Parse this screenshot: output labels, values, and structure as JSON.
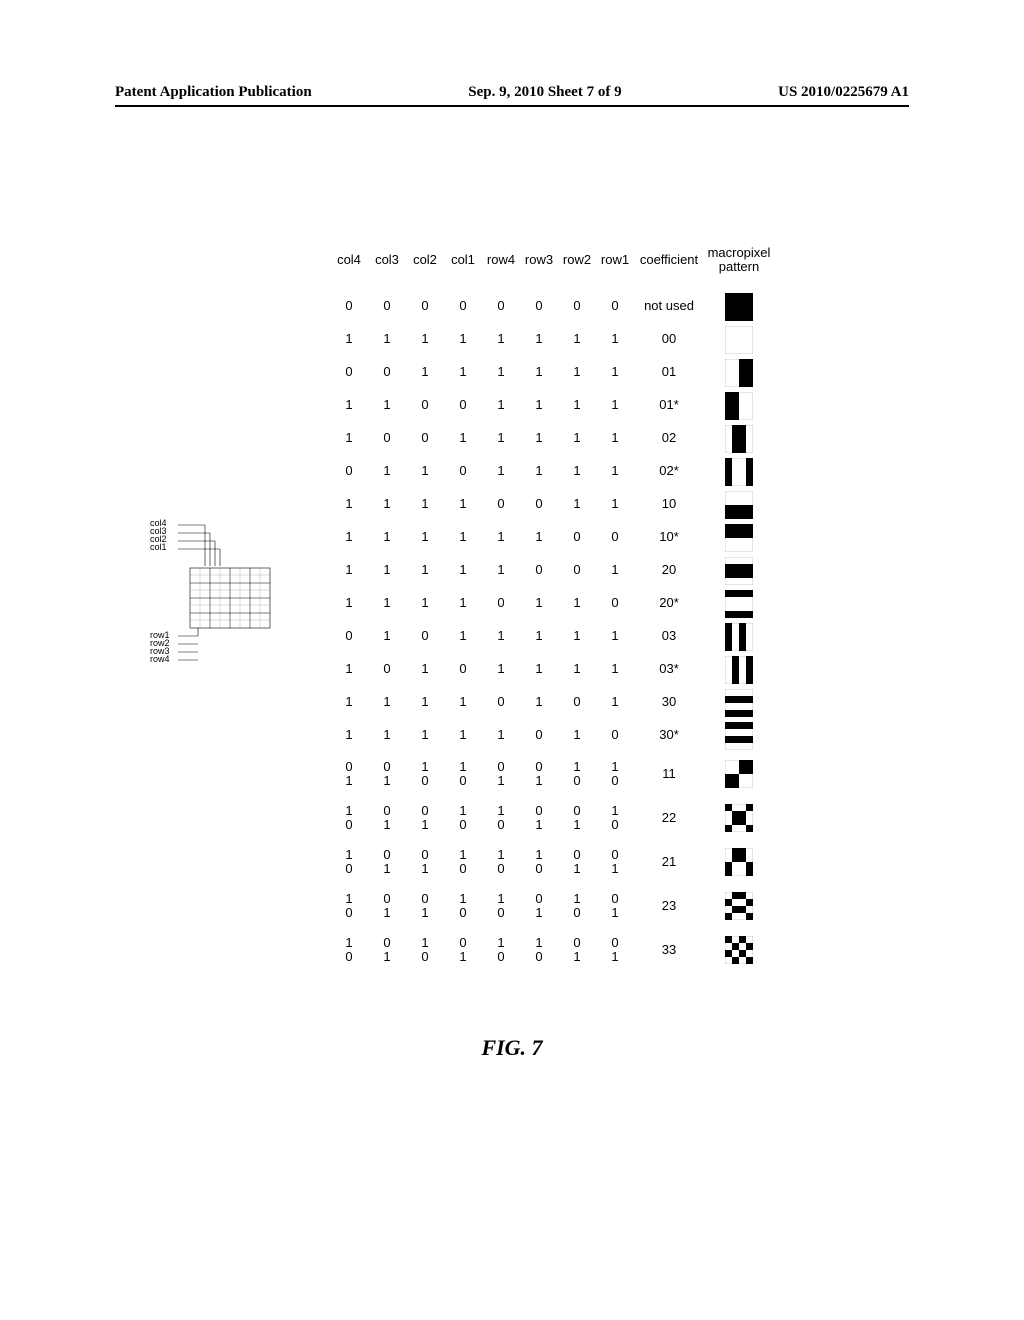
{
  "header": {
    "left": "Patent Application Publication",
    "center": "Sep. 9, 2010  Sheet 7 of 9",
    "right": "US 2010/0225679 A1"
  },
  "figure_caption": "FIG. 7",
  "table": {
    "headers": [
      "col4",
      "col3",
      "col2",
      "col1",
      "row4",
      "row3",
      "row2",
      "row1",
      "coefficient",
      "macropixel pattern"
    ],
    "rows": [
      {
        "cols": [
          "0",
          "0",
          "0",
          "0",
          "0",
          "0",
          "0",
          "0"
        ],
        "coef": "not used",
        "pat": "full"
      },
      {
        "cols": [
          "1",
          "1",
          "1",
          "1",
          "1",
          "1",
          "1",
          "1"
        ],
        "coef": "00",
        "pat": "empty"
      },
      {
        "cols": [
          "0",
          "0",
          "1",
          "1",
          "1",
          "1",
          "1",
          "1"
        ],
        "coef": "01",
        "pat": "right-half"
      },
      {
        "cols": [
          "1",
          "1",
          "0",
          "0",
          "1",
          "1",
          "1",
          "1"
        ],
        "coef": "01*",
        "pat": "left-half"
      },
      {
        "cols": [
          "1",
          "0",
          "0",
          "1",
          "1",
          "1",
          "1",
          "1"
        ],
        "coef": "02",
        "pat": "mid-cols"
      },
      {
        "cols": [
          "0",
          "1",
          "1",
          "0",
          "1",
          "1",
          "1",
          "1"
        ],
        "coef": "02*",
        "pat": "out-cols"
      },
      {
        "cols": [
          "1",
          "1",
          "1",
          "1",
          "0",
          "0",
          "1",
          "1"
        ],
        "coef": "10",
        "pat": "bot-half"
      },
      {
        "cols": [
          "1",
          "1",
          "1",
          "1",
          "1",
          "1",
          "0",
          "0"
        ],
        "coef": "10*",
        "pat": "top-half"
      },
      {
        "cols": [
          "1",
          "1",
          "1",
          "1",
          "1",
          "0",
          "0",
          "1"
        ],
        "coef": "20",
        "pat": "mid-rows"
      },
      {
        "cols": [
          "1",
          "1",
          "1",
          "1",
          "0",
          "1",
          "1",
          "0"
        ],
        "coef": "20*",
        "pat": "out-rows"
      },
      {
        "cols": [
          "0",
          "1",
          "0",
          "1",
          "1",
          "1",
          "1",
          "1"
        ],
        "coef": "03",
        "pat": "alt-cols-a"
      },
      {
        "cols": [
          "1",
          "0",
          "1",
          "0",
          "1",
          "1",
          "1",
          "1"
        ],
        "coef": "03*",
        "pat": "alt-cols-b"
      },
      {
        "cols": [
          "1",
          "1",
          "1",
          "1",
          "0",
          "1",
          "0",
          "1"
        ],
        "coef": "30",
        "pat": "alt-rows-a"
      },
      {
        "cols": [
          "1",
          "1",
          "1",
          "1",
          "1",
          "0",
          "1",
          "0"
        ],
        "coef": "30*",
        "pat": "alt-rows-b"
      },
      {
        "colsA": [
          "0",
          "0",
          "1",
          "1",
          "0",
          "0",
          "1",
          "1"
        ],
        "colsB": [
          "1",
          "1",
          "0",
          "0",
          "1",
          "1",
          "0",
          "0"
        ],
        "coef": "11",
        "pat": "diag2"
      },
      {
        "colsA": [
          "1",
          "0",
          "0",
          "1",
          "1",
          "0",
          "0",
          "1"
        ],
        "colsB": [
          "0",
          "1",
          "1",
          "0",
          "0",
          "1",
          "1",
          "0"
        ],
        "coef": "22",
        "pat": "p22"
      },
      {
        "colsA": [
          "1",
          "0",
          "0",
          "1",
          "1",
          "1",
          "0",
          "0"
        ],
        "colsB": [
          "0",
          "1",
          "1",
          "0",
          "0",
          "0",
          "1",
          "1"
        ],
        "coef": "21",
        "pat": "p21"
      },
      {
        "colsA": [
          "1",
          "0",
          "0",
          "1",
          "1",
          "0",
          "1",
          "0"
        ],
        "colsB": [
          "0",
          "1",
          "1",
          "0",
          "0",
          "1",
          "0",
          "1"
        ],
        "coef": "23",
        "pat": "p23"
      },
      {
        "colsA": [
          "1",
          "0",
          "1",
          "0",
          "1",
          "1",
          "0",
          "0"
        ],
        "colsB": [
          "0",
          "1",
          "0",
          "1",
          "0",
          "0",
          "1",
          "1"
        ],
        "coef": "33",
        "pat": "p33"
      }
    ]
  },
  "diagram": {
    "col_labels": [
      "col4",
      "col3",
      "col2",
      "col1"
    ],
    "row_labels": [
      "row1",
      "row2",
      "row3",
      "row4"
    ]
  }
}
